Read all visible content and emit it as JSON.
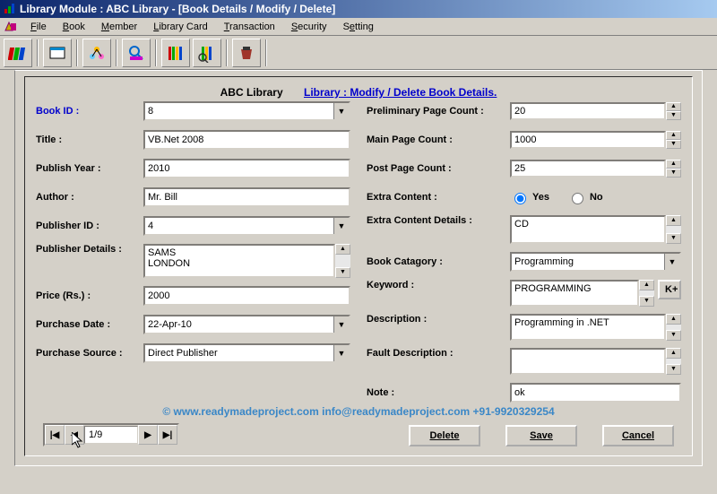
{
  "window": {
    "title": "Library Module : ABC Library - [Book Details / Modify / Delete]"
  },
  "menu": {
    "items": [
      "File",
      "Book",
      "Member",
      "Library Card",
      "Transaction",
      "Security",
      "Setting"
    ]
  },
  "header": {
    "library_name": "ABC Library",
    "link_text": "Library : Modify / Delete Book Details."
  },
  "left": {
    "book_id": {
      "label": "Book ID :",
      "value": "8"
    },
    "title": {
      "label": "Title :",
      "value": "VB.Net 2008"
    },
    "publish_year": {
      "label": "Publish Year :",
      "value": "2010"
    },
    "author": {
      "label": "Author :",
      "value": "Mr. Bill"
    },
    "publisher_id": {
      "label": "Publisher ID :",
      "value": "4"
    },
    "publisher_details": {
      "label": "Publisher Details :",
      "value": "SAMS\nLONDON"
    },
    "price": {
      "label": "Price (Rs.) :",
      "value": "2000"
    },
    "purchase_date": {
      "label": "Purchase Date :",
      "value": "22-Apr-10"
    },
    "purchase_source": {
      "label": "Purchase Source :",
      "value": "Direct Publisher"
    }
  },
  "right": {
    "prelim_page": {
      "label": "Preliminary Page Count :",
      "value": "20"
    },
    "main_page": {
      "label": "Main Page Count :",
      "value": "1000"
    },
    "post_page": {
      "label": "Post Page Count :",
      "value": "25"
    },
    "extra_content": {
      "label": "Extra Content :",
      "yes": "Yes",
      "no": "No",
      "selected": "yes"
    },
    "extra_details": {
      "label": "Extra Content Details :",
      "value": "CD"
    },
    "category": {
      "label": "Book Catagory :",
      "value": "Programming"
    },
    "keyword": {
      "label": "Keyword :",
      "value": "PROGRAMMING",
      "kplus": "K+"
    },
    "description": {
      "label": "Description :",
      "value": "Programming in .NET"
    },
    "fault": {
      "label": "Fault Description :",
      "value": ""
    },
    "note": {
      "label": "Note :",
      "value": "ok"
    }
  },
  "nav": {
    "position": "1/9"
  },
  "buttons": {
    "delete": "Delete",
    "save": "Save",
    "cancel": "Cancel"
  },
  "watermark": "©  www.readymadeproject.com  info@readymadeproject.com  +91-9920329254"
}
